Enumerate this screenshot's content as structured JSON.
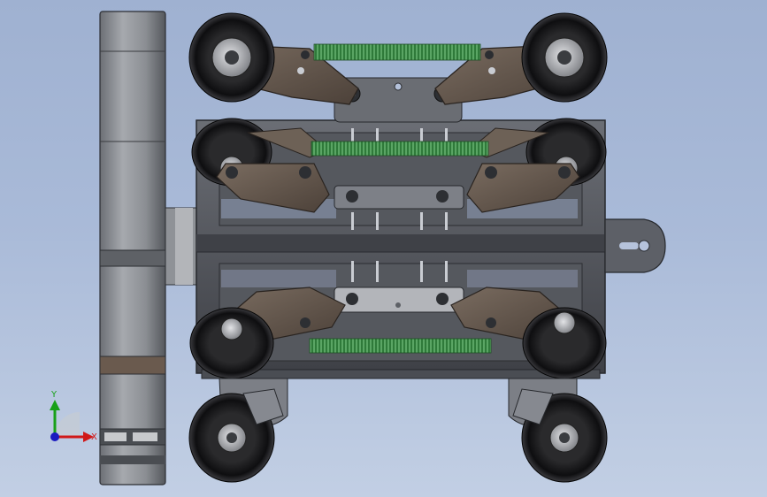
{
  "viewport": {
    "title": "",
    "background_top": "#9fb1d1",
    "background_bottom": "#c2cfe4"
  },
  "triad": {
    "x_label": "X",
    "y_label": "Y",
    "x_color": "#d01818",
    "y_color": "#18a018",
    "z_color": "#1a1ac0"
  },
  "model": {
    "part_metal_color": "#5c5f66",
    "bracket_color": "#6e6054",
    "spring_color": "#2f7a3a",
    "wheel_color": "#121214",
    "plate_color": "#8d8f96"
  }
}
